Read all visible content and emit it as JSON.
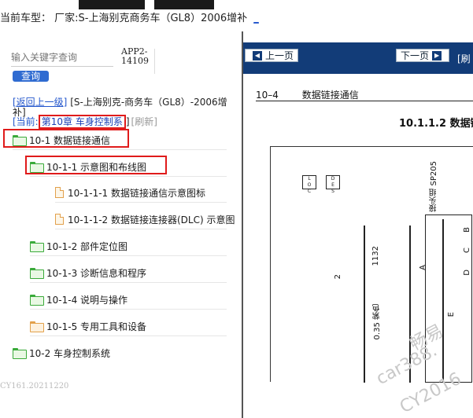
{
  "topbar": {
    "car_label": "当前车型：",
    "car_value": "厂家:S-上海别克商务车（GL8）2006增补",
    "car_link": "_"
  },
  "search": {
    "placeholder": "输入关键字查询",
    "button_label": "查询"
  },
  "app_code": "APP2-14109",
  "breadcrumb": {
    "back_label": "[返回上一级]",
    "path": "[S-上海别克-商务车（GL8）-2006增补]"
  },
  "current": {
    "label": "[当前:",
    "chapter": "第10章 车身控制系",
    "close": "]",
    "refresh": "[刷新]"
  },
  "tree": [
    {
      "label": "10-1 数据链接通信",
      "icon": "folder-icon"
    },
    {
      "label": "10-1-1 示意图和布线图",
      "icon": "folder-icon"
    },
    {
      "label": "10-1-1-1 数据链接通信示意图标",
      "icon": "document-icon"
    },
    {
      "label": "10-1-1-2 数据链接连接器(DLC) 示意图",
      "icon": "document-icon"
    },
    {
      "label": "10-1-2 部件定位图",
      "icon": "folder-icon"
    },
    {
      "label": "10-1-3 诊断信息和程序",
      "icon": "folder-icon"
    },
    {
      "label": "10-1-4 说明与操作",
      "icon": "folder-icon"
    },
    {
      "label": "10-1-5 专用工具和设备",
      "icon": "folder-open-orange-icon"
    },
    {
      "label": "10-2 车身控制系统",
      "icon": "folder-icon"
    }
  ],
  "footer_id": "CY161.20211220",
  "viewer": {
    "prev_label": "上一页",
    "next_label": "下一页",
    "extra_label": "[刷",
    "page_num": "10–4",
    "page_title": "数据链接通信",
    "sub_title": "10.1.1.2 数据链",
    "wire_label": "0.35 紫色",
    "wire_num": "1132",
    "pin_2": "2",
    "connector_label": "接头组 SP205",
    "pins": [
      "A",
      "B",
      "C",
      "D",
      "E"
    ],
    "watermark_1": "畅易",
    "watermark_2": "car388.",
    "watermark_3": "CY2016"
  },
  "colors": {
    "nav_blue": "#123c78",
    "highlight_red": "#e01b1b",
    "link_blue": "#2255cc",
    "folder_green": "#3aaa3a",
    "doc_orange": "#e2a04b"
  }
}
